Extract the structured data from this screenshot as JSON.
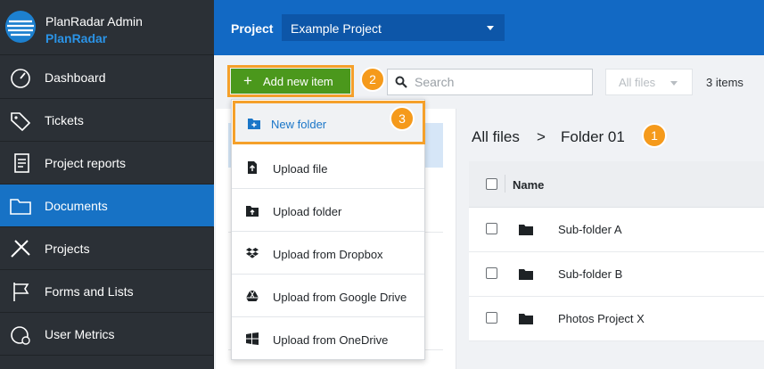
{
  "brand": {
    "name": "PlanRadar Admin",
    "sub": "PlanRadar"
  },
  "sidebar": {
    "items": [
      {
        "label": "Dashboard",
        "icon": "gauge-icon",
        "active": false
      },
      {
        "label": "Tickets",
        "icon": "tag-icon",
        "active": false
      },
      {
        "label": "Project reports",
        "icon": "report-icon",
        "active": false
      },
      {
        "label": "Documents",
        "icon": "folder-icon",
        "active": true
      },
      {
        "label": "Projects",
        "icon": "pencil-ruler-icon",
        "active": false
      },
      {
        "label": "Forms and Lists",
        "icon": "flag-icon",
        "active": false
      },
      {
        "label": "User Metrics",
        "icon": "user-metrics-icon",
        "active": false
      }
    ]
  },
  "header": {
    "project_label": "Project",
    "project_value": "Example Project"
  },
  "toolbar": {
    "add_label": "Add new item",
    "search_placeholder": "Search",
    "filter_value": "All files",
    "items_count": "3 items"
  },
  "breadcrumb": {
    "root": "All files",
    "separator": ">",
    "current": "Folder 01"
  },
  "table": {
    "header_name": "Name",
    "rows": [
      {
        "name": "Sub-folder A"
      },
      {
        "name": "Sub-folder B"
      },
      {
        "name": "Photos Project X"
      }
    ]
  },
  "menu": {
    "items": [
      {
        "label": "New folder",
        "icon": "new-folder-icon"
      },
      {
        "label": "Upload file",
        "icon": "upload-file-icon"
      },
      {
        "label": "Upload folder",
        "icon": "upload-folder-icon"
      },
      {
        "label": "Upload from Dropbox",
        "icon": "dropbox-icon"
      },
      {
        "label": "Upload from Google Drive",
        "icon": "google-drive-icon"
      },
      {
        "label": "Upload from OneDrive",
        "icon": "windows-icon"
      }
    ]
  },
  "callouts": [
    "1",
    "2",
    "3"
  ],
  "colors": {
    "accent": "#1269c4",
    "highlight": "#f5a02a",
    "add_button": "#4b981c",
    "sidebar": "#2b3036",
    "active_nav": "#1772c5"
  }
}
